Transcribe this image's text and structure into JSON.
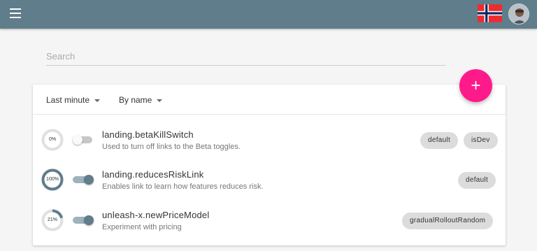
{
  "header": {
    "menu_icon": "hamburger-menu-icon",
    "flag_icon": "norway-flag-icon",
    "avatar_icon": "user-avatar"
  },
  "search": {
    "placeholder": "Search",
    "value": ""
  },
  "filters": {
    "time": "Last minute",
    "sort": "By name"
  },
  "add_button": {
    "label": "+"
  },
  "features": [
    {
      "name": "landing.betaKillSwitch",
      "description": "Used to turn off links to the Beta toggles.",
      "percent_label": "0%",
      "percent": 0,
      "enabled": false,
      "strategies": [
        "default",
        "isDev"
      ]
    },
    {
      "name": "landing.reducesRiskLink",
      "description": "Enables link to learn how features reduces risk.",
      "percent_label": "100%",
      "percent": 100,
      "enabled": true,
      "strategies": [
        "default"
      ]
    },
    {
      "name": "unleash-x.newPriceModel",
      "description": "Experiment with pricing",
      "percent_label": "21%",
      "percent": 21,
      "enabled": true,
      "strategies": [
        "gradualRolloutRandom"
      ]
    }
  ],
  "colors": {
    "header": "#607d8b",
    "accent": "#ff1a8c",
    "gauge_fill": "#607d8b",
    "gauge_track": "#e0e0e0"
  }
}
